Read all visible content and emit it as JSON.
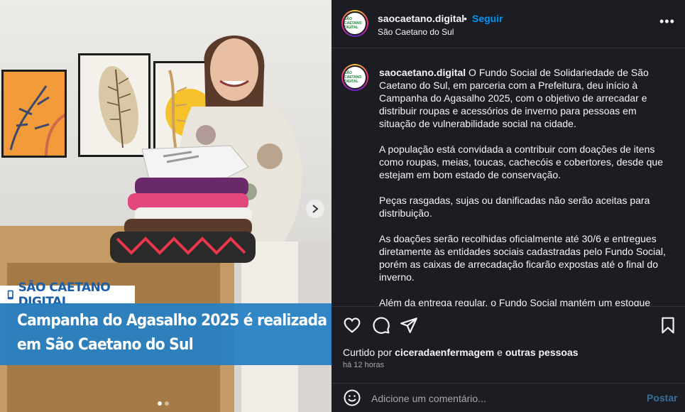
{
  "photo": {
    "banner_brand": "SÃO CAETANO DIGITAL",
    "headline_line1": "Campanha do Agasalho 2025 é realizada",
    "headline_line2": "em São Caetano do Sul",
    "carousel": {
      "total": 2,
      "current": 1
    }
  },
  "header": {
    "username": "saocaetano.digital",
    "separator": "•",
    "follow_label": "Seguir",
    "location": "São Caetano do Sul",
    "more_icon": "more-horizontal-icon"
  },
  "post": {
    "avatar_text": "SÃO CAETANO DIGITAL",
    "username": "saocaetano.digital",
    "paragraphs": [
      "O Fundo Social de Solidariedade de São Caetano do Sul, em parceria com a Prefeitura, deu início à Campanha do Agasalho 2025, com o objetivo de arrecadar e distribuir roupas e acessórios de inverno para pessoas em situação de vulnerabilidade social na cidade.",
      "A população está convidada a contribuir com doações de itens como roupas, meias, toucas, cachecóis e cobertores, desde que estejam em bom estado de conservação.",
      "Peças rasgadas, sujas ou danificadas não serão aceitas para distribuição.",
      "As doações serão recolhidas oficialmente até 30/6 e entregues diretamente às entidades sociais cadastradas pelo Fundo Social, porém as caixas de arrecadação ficarão expostas até o final do inverno.",
      "Além da entrega regular, o Fundo Social mantém um estoque"
    ]
  },
  "engagement": {
    "liked_prefix": "Curtido por",
    "liked_user": "ciceradaenfermagem",
    "liked_joiner": "e",
    "liked_others": "outras pessoas",
    "time": "há 12 horas"
  },
  "comment": {
    "placeholder": "Adicione um comentário...",
    "post_label": "Postar"
  },
  "colors": {
    "accent": "#0095f6",
    "panel_bg": "#1b1d22",
    "banner_blue": "#2480c4"
  }
}
